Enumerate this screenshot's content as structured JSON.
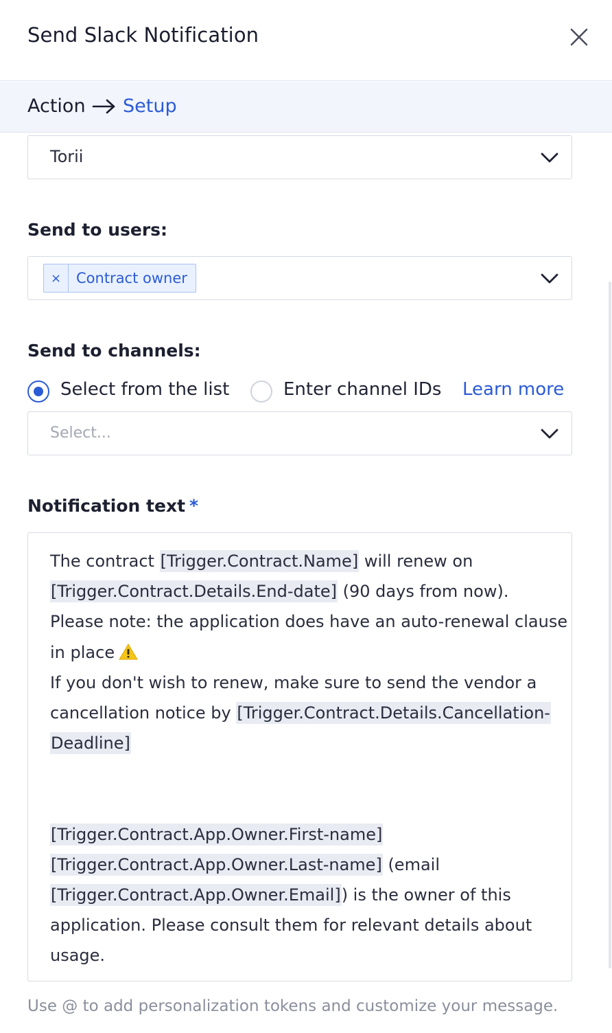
{
  "dialog": {
    "title": "Send Slack Notification",
    "close_icon": "close-icon"
  },
  "breadcrumb": {
    "step1": "Action",
    "arrow_icon": "arrow-right-icon",
    "step2": "Setup"
  },
  "workspace_select": {
    "value": "Torii",
    "icon": "chevron-down-icon"
  },
  "send_to_users": {
    "label": "Send to users:",
    "tag_remove": "×",
    "tag_label": "Contract owner"
  },
  "send_to_channels": {
    "label": "Send to channels:",
    "option1": "Select from the list",
    "option2": "Enter channel IDs",
    "selected_option": "Select from the list",
    "learn_more": "Learn more",
    "select_placeholder": "Select..."
  },
  "notification_text": {
    "label": "Notification text",
    "required_marker": "*",
    "line1_a": "The contract ",
    "line1_token": "[Trigger.Contract.Name]",
    "line1_b": " will renew on",
    "line2_token": "[Trigger.Contract.Details.End-date]",
    "line2_b": " (90 days from now).",
    "line3": "Please note: the application does have an auto-renewal clause",
    "line4": "in place",
    "warning_icon": "warning-icon",
    "line5": " If you don't wish to renew, make sure to send the vendor a",
    "line6_a": "cancellation notice by ",
    "line6_token": "[Trigger.Contract.Details.Cancellation-",
    "line7_token": "Deadline]",
    "line8_token": "[Trigger.Contract.App.Owner.First-name]",
    "line9_token": "[Trigger.Contract.App.Owner.Last-name]",
    "line9_b": " (email",
    "line10_token": "[Trigger.Contract.App.Owner.Email]",
    "line10_b": ") is the owner of this",
    "line11": "application. Please consult them for relevant details about",
    "line12": "usage."
  },
  "hint": "Use @ to add personalization tokens and customize your message.",
  "colors": {
    "accent": "#2a5bd7",
    "token_bg": "#e8ebf2",
    "breadcrumb_bg": "#f2f5fc",
    "warning": "#f5c518"
  }
}
